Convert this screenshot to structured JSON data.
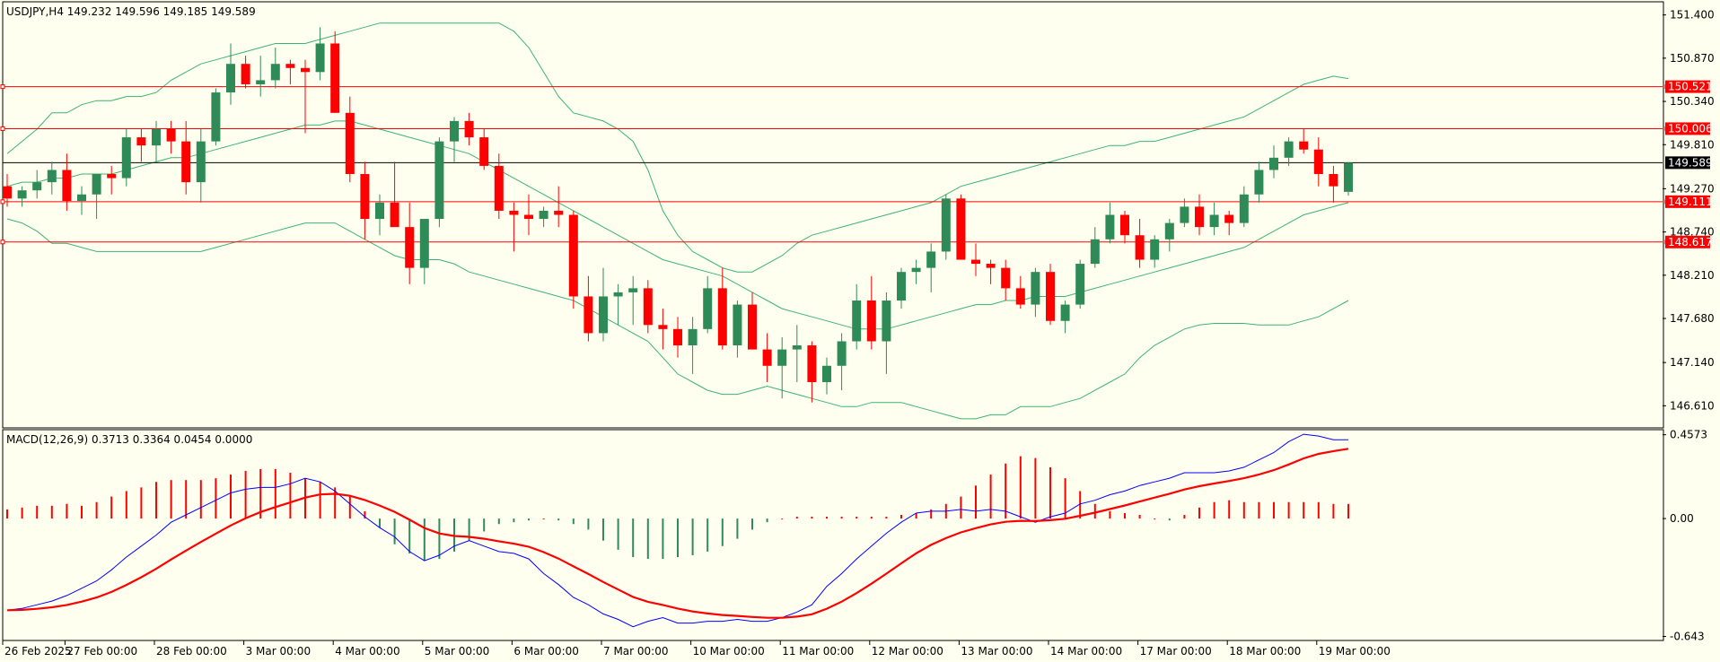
{
  "header": {
    "symbol_info": "USDJPY,H4  149.232 149.596 149.185 149.589",
    "macd_info": "MACD(12,26,9) 0.3713 0.3364 0.0454 0.0000"
  },
  "colors": {
    "background": "#fffff0",
    "bull": "#2e8b57",
    "bear": "#ff0000",
    "bands": "#3cb371",
    "level_line": "#ff0000",
    "current_line": "#000000",
    "macd_main": "#0000ff",
    "macd_signal": "#ff0000"
  },
  "chart_data": [
    {
      "type": "candlestick",
      "title": "USDJPY,H4",
      "ylim": [
        146.35,
        151.55
      ],
      "y_ticks": [
        "151.400",
        "150.870",
        "150.340",
        "149.810",
        "149.270",
        "148.740",
        "148.210",
        "147.680",
        "147.140",
        "146.610"
      ],
      "x_tick_labels": [
        "26 Feb 2025",
        "27 Feb 00:00",
        "28 Feb 00:00",
        "3 Mar 00:00",
        "4 Mar 00:00",
        "5 Mar 00:00",
        "6 Mar 00:00",
        "7 Mar 00:00",
        "10 Mar 00:00",
        "11 Mar 00:00",
        "12 Mar 00:00",
        "13 Mar 00:00",
        "14 Mar 00:00",
        "17 Mar 00:00",
        "18 Mar 00:00",
        "19 Mar 00:00"
      ],
      "levels": [
        {
          "value": 150.521,
          "label": "150.521"
        },
        {
          "value": 150.006,
          "label": "150.006"
        },
        {
          "value": 149.111,
          "label": "149.111"
        },
        {
          "value": 148.617,
          "label": "148.617"
        }
      ],
      "current_price": {
        "value": 149.589,
        "label": "149.589"
      },
      "ohlc": [
        [
          149.3,
          149.45,
          149.05,
          149.15
        ],
        [
          149.15,
          149.3,
          149.05,
          149.25
        ],
        [
          149.25,
          149.5,
          149.15,
          149.35
        ],
        [
          149.35,
          149.6,
          149.2,
          149.5
        ],
        [
          149.5,
          149.7,
          149.0,
          149.12
        ],
        [
          149.12,
          149.3,
          148.95,
          149.2
        ],
        [
          149.2,
          149.4,
          148.9,
          149.45
        ],
        [
          149.45,
          149.55,
          149.2,
          149.4
        ],
        [
          149.4,
          150.0,
          149.3,
          149.9
        ],
        [
          149.9,
          150.0,
          149.6,
          149.8
        ],
        [
          149.8,
          150.1,
          149.6,
          150.0
        ],
        [
          150.0,
          150.1,
          149.7,
          149.85
        ],
        [
          149.85,
          150.1,
          149.2,
          149.35
        ],
        [
          149.35,
          150.0,
          149.1,
          149.85
        ],
        [
          149.85,
          150.5,
          149.8,
          150.45
        ],
        [
          150.45,
          151.05,
          150.3,
          150.8
        ],
        [
          150.8,
          150.9,
          150.5,
          150.55
        ],
        [
          150.55,
          150.9,
          150.4,
          150.6
        ],
        [
          150.6,
          151.0,
          150.5,
          150.8
        ],
        [
          150.8,
          150.85,
          150.55,
          150.75
        ],
        [
          150.75,
          150.85,
          149.95,
          150.7
        ],
        [
          150.7,
          151.25,
          150.6,
          151.05
        ],
        [
          151.05,
          151.2,
          150.2,
          150.2
        ],
        [
          150.2,
          150.4,
          149.35,
          149.45
        ],
        [
          149.45,
          149.6,
          148.65,
          148.9
        ],
        [
          148.9,
          149.2,
          148.7,
          149.1
        ],
        [
          149.1,
          149.6,
          148.9,
          148.8
        ],
        [
          148.8,
          149.1,
          148.1,
          148.3
        ],
        [
          148.3,
          148.9,
          148.1,
          148.9
        ],
        [
          148.9,
          149.9,
          148.8,
          149.85
        ],
        [
          149.85,
          150.15,
          149.6,
          150.1
        ],
        [
          150.1,
          150.2,
          149.8,
          149.9
        ],
        [
          149.9,
          150.0,
          149.5,
          149.55
        ],
        [
          149.55,
          149.7,
          148.9,
          149.0
        ],
        [
          149.0,
          149.1,
          148.5,
          148.95
        ],
        [
          148.95,
          149.2,
          148.7,
          148.9
        ],
        [
          148.9,
          149.05,
          148.8,
          149.0
        ],
        [
          149.0,
          149.3,
          148.8,
          148.95
        ],
        [
          148.95,
          149.0,
          147.8,
          147.95
        ],
        [
          147.95,
          148.2,
          147.4,
          147.5
        ],
        [
          147.5,
          148.3,
          147.4,
          147.95
        ],
        [
          147.95,
          148.1,
          147.6,
          148.0
        ],
        [
          148.0,
          148.2,
          147.6,
          148.05
        ],
        [
          148.05,
          148.15,
          147.5,
          147.6
        ],
        [
          147.6,
          147.8,
          147.3,
          147.55
        ],
        [
          147.55,
          147.7,
          147.2,
          147.35
        ],
        [
          147.35,
          147.7,
          147.0,
          147.55
        ],
        [
          147.55,
          148.2,
          147.5,
          148.05
        ],
        [
          148.05,
          148.3,
          147.3,
          147.35
        ],
        [
          147.35,
          147.9,
          147.2,
          147.85
        ],
        [
          147.85,
          148.0,
          147.3,
          147.3
        ],
        [
          147.3,
          147.5,
          146.9,
          147.1
        ],
        [
          147.1,
          147.45,
          146.7,
          147.3
        ],
        [
          147.3,
          147.6,
          146.9,
          147.35
        ],
        [
          147.35,
          147.4,
          146.65,
          146.9
        ],
        [
          146.9,
          147.2,
          146.75,
          147.1
        ],
        [
          147.1,
          147.5,
          146.8,
          147.4
        ],
        [
          147.4,
          148.1,
          147.3,
          147.9
        ],
        [
          147.9,
          148.2,
          147.3,
          147.4
        ],
        [
          147.4,
          148.0,
          147.0,
          147.9
        ],
        [
          147.9,
          148.3,
          147.8,
          148.25
        ],
        [
          148.25,
          148.4,
          148.1,
          148.3
        ],
        [
          148.3,
          148.6,
          148.0,
          148.5
        ],
        [
          148.5,
          149.2,
          148.4,
          149.15
        ],
        [
          149.15,
          149.2,
          148.4,
          148.4
        ],
        [
          148.4,
          148.6,
          148.2,
          148.35
        ],
        [
          148.35,
          148.4,
          148.1,
          148.3
        ],
        [
          148.3,
          148.4,
          147.9,
          148.05
        ],
        [
          148.05,
          148.2,
          147.8,
          147.85
        ],
        [
          147.85,
          148.3,
          147.7,
          148.25
        ],
        [
          148.25,
          148.35,
          147.6,
          147.65
        ],
        [
          147.65,
          147.9,
          147.5,
          147.85
        ],
        [
          147.85,
          148.4,
          147.8,
          148.35
        ],
        [
          148.35,
          148.8,
          148.3,
          148.65
        ],
        [
          148.65,
          149.1,
          148.6,
          148.95
        ],
        [
          148.95,
          149.0,
          148.6,
          148.7
        ],
        [
          148.7,
          148.9,
          148.3,
          148.4
        ],
        [
          148.4,
          148.7,
          148.3,
          148.65
        ],
        [
          148.65,
          148.9,
          148.5,
          148.85
        ],
        [
          148.85,
          149.15,
          148.8,
          149.05
        ],
        [
          149.05,
          149.2,
          148.7,
          148.8
        ],
        [
          148.8,
          149.1,
          148.7,
          148.95
        ],
        [
          148.95,
          149.0,
          148.7,
          148.85
        ],
        [
          148.85,
          149.3,
          148.8,
          149.2
        ],
        [
          149.2,
          149.6,
          149.1,
          149.5
        ],
        [
          149.5,
          149.8,
          149.4,
          149.65
        ],
        [
          149.65,
          149.9,
          149.55,
          149.85
        ],
        [
          149.85,
          150.0,
          149.7,
          149.75
        ],
        [
          149.75,
          149.9,
          149.3,
          149.45
        ],
        [
          149.45,
          149.55,
          149.1,
          149.3
        ],
        [
          149.232,
          149.596,
          149.185,
          149.589
        ]
      ],
      "bollinger": {
        "upper": [
          149.7,
          149.85,
          150.0,
          150.2,
          150.2,
          150.3,
          150.35,
          150.35,
          150.4,
          150.4,
          150.45,
          150.6,
          150.7,
          150.8,
          150.85,
          150.9,
          150.95,
          151.0,
          151.05,
          151.05,
          151.05,
          151.1,
          151.15,
          151.2,
          151.25,
          151.3,
          151.3,
          151.3,
          151.3,
          151.3,
          151.3,
          151.3,
          151.3,
          151.3,
          151.2,
          151.0,
          150.7,
          150.4,
          150.2,
          150.15,
          150.1,
          150.0,
          149.85,
          149.5,
          149.0,
          148.7,
          148.5,
          148.4,
          148.3,
          148.25,
          148.25,
          148.35,
          148.45,
          148.6,
          148.7,
          148.75,
          148.8,
          148.85,
          148.9,
          148.95,
          149.0,
          149.05,
          149.1,
          149.2,
          149.3,
          149.35,
          149.4,
          149.45,
          149.5,
          149.55,
          149.6,
          149.65,
          149.7,
          149.75,
          149.8,
          149.8,
          149.85,
          149.85,
          149.9,
          149.95,
          150.0,
          150.05,
          150.1,
          150.15,
          150.25,
          150.35,
          150.45,
          150.55,
          150.6,
          150.65,
          150.62
        ],
        "middle": [
          149.3,
          149.35,
          149.35,
          149.4,
          149.4,
          149.45,
          149.45,
          149.45,
          149.5,
          149.55,
          149.6,
          149.65,
          149.65,
          149.7,
          149.75,
          149.8,
          149.85,
          149.9,
          149.95,
          150.0,
          150.05,
          150.05,
          150.1,
          150.1,
          150.05,
          150.0,
          149.95,
          149.9,
          149.85,
          149.8,
          149.75,
          149.7,
          149.6,
          149.5,
          149.4,
          149.3,
          149.2,
          149.1,
          149.0,
          148.9,
          148.8,
          148.7,
          148.6,
          148.5,
          148.4,
          148.35,
          148.3,
          148.25,
          148.2,
          148.1,
          148.0,
          147.9,
          147.8,
          147.75,
          147.7,
          147.65,
          147.6,
          147.55,
          147.55,
          147.55,
          147.6,
          147.65,
          147.7,
          147.75,
          147.8,
          147.85,
          147.85,
          147.9,
          147.9,
          147.95,
          147.95,
          147.95,
          148.0,
          148.05,
          148.1,
          148.15,
          148.2,
          148.25,
          148.3,
          148.35,
          148.4,
          148.45,
          148.5,
          148.55,
          148.65,
          148.75,
          148.85,
          148.95,
          149.0,
          149.05,
          149.1
        ],
        "lower": [
          148.9,
          148.85,
          148.75,
          148.6,
          148.6,
          148.55,
          148.5,
          148.5,
          148.5,
          148.5,
          148.5,
          148.5,
          148.5,
          148.5,
          148.55,
          148.6,
          148.65,
          148.7,
          148.75,
          148.8,
          148.85,
          148.85,
          148.85,
          148.75,
          148.65,
          148.55,
          148.45,
          148.4,
          148.4,
          148.4,
          148.35,
          148.25,
          148.2,
          148.15,
          148.1,
          148.05,
          148.0,
          147.95,
          147.9,
          147.8,
          147.7,
          147.6,
          147.5,
          147.4,
          147.2,
          147.0,
          146.9,
          146.8,
          146.75,
          146.75,
          146.8,
          146.85,
          146.8,
          146.75,
          146.7,
          146.65,
          146.6,
          146.6,
          146.65,
          146.65,
          146.65,
          146.6,
          146.55,
          146.5,
          146.45,
          146.45,
          146.5,
          146.5,
          146.6,
          146.6,
          146.6,
          146.65,
          146.7,
          146.8,
          146.9,
          147.0,
          147.2,
          147.35,
          147.45,
          147.55,
          147.6,
          147.62,
          147.62,
          147.62,
          147.6,
          147.6,
          147.6,
          147.65,
          147.7,
          147.8,
          147.9
        ]
      }
    },
    {
      "type": "macd",
      "title": "MACD(12,26,9)",
      "ylim": [
        -0.66,
        0.48
      ],
      "y_ticks": [
        "0.4573",
        "0.00",
        "-0.643"
      ],
      "histogram": [
        0.05,
        0.06,
        0.07,
        0.07,
        0.08,
        0.07,
        0.09,
        0.12,
        0.15,
        0.17,
        0.2,
        0.21,
        0.21,
        0.21,
        0.22,
        0.24,
        0.26,
        0.27,
        0.27,
        0.25,
        0.22,
        0.2,
        0.17,
        0.12,
        0.04,
        -0.05,
        -0.14,
        -0.19,
        -0.23,
        -0.22,
        -0.18,
        -0.12,
        -0.07,
        -0.03,
        -0.02,
        -0.01,
        0.0,
        -0.01,
        -0.03,
        -0.06,
        -0.12,
        -0.17,
        -0.21,
        -0.22,
        -0.22,
        -0.21,
        -0.2,
        -0.18,
        -0.15,
        -0.11,
        -0.06,
        -0.02,
        0.0,
        0.01,
        0.01,
        0.01,
        0.01,
        0.01,
        0.01,
        0.01,
        0.02,
        0.03,
        0.05,
        0.08,
        0.12,
        0.18,
        0.24,
        0.3,
        0.34,
        0.33,
        0.28,
        0.22,
        0.15,
        0.08,
        0.04,
        0.03,
        0.02,
        0.0,
        -0.01,
        0.02,
        0.06,
        0.09,
        0.1,
        0.09,
        0.09,
        0.09,
        0.09,
        0.09,
        0.09,
        0.08,
        0.08
      ],
      "main": [
        -0.5,
        -0.49,
        -0.47,
        -0.45,
        -0.42,
        -0.38,
        -0.34,
        -0.28,
        -0.21,
        -0.15,
        -0.09,
        -0.02,
        0.02,
        0.06,
        0.1,
        0.14,
        0.16,
        0.17,
        0.17,
        0.19,
        0.22,
        0.2,
        0.15,
        0.08,
        0.01,
        -0.05,
        -0.1,
        -0.18,
        -0.23,
        -0.2,
        -0.15,
        -0.12,
        -0.15,
        -0.18,
        -0.19,
        -0.22,
        -0.3,
        -0.36,
        -0.43,
        -0.47,
        -0.52,
        -0.55,
        -0.59,
        -0.56,
        -0.54,
        -0.57,
        -0.57,
        -0.56,
        -0.56,
        -0.55,
        -0.56,
        -0.56,
        -0.54,
        -0.51,
        -0.47,
        -0.37,
        -0.3,
        -0.22,
        -0.15,
        -0.08,
        -0.02,
        0.03,
        0.04,
        0.04,
        0.05,
        0.04,
        0.05,
        0.04,
        0.01,
        -0.02,
        0.01,
        0.03,
        0.08,
        0.1,
        0.13,
        0.15,
        0.18,
        0.2,
        0.22,
        0.25,
        0.25,
        0.25,
        0.26,
        0.28,
        0.32,
        0.36,
        0.42,
        0.46,
        0.45,
        0.43,
        0.43
      ]
    }
  ]
}
